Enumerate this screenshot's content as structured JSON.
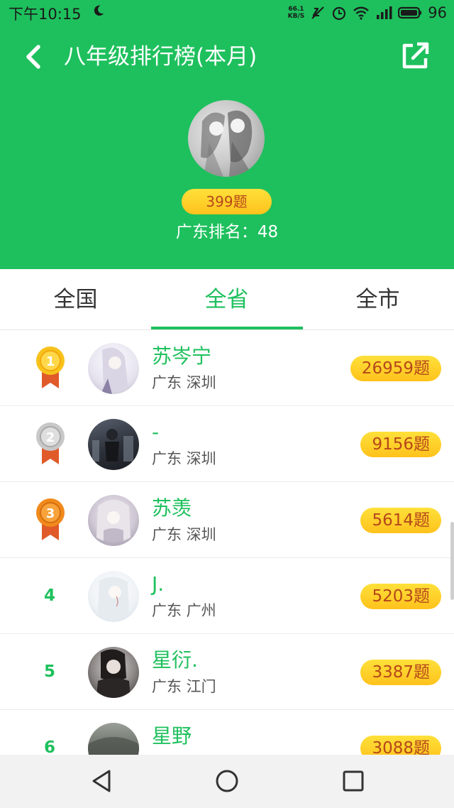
{
  "status_bar": {
    "time": "下午10:15",
    "net_speed_value": "66.1",
    "net_speed_unit": "KB/S",
    "battery": "96"
  },
  "header": {
    "title": "八年级排行榜(本月)",
    "my_score": "399题",
    "my_rank": "广东排名：48"
  },
  "tabs": [
    {
      "label": "全国",
      "active": false
    },
    {
      "label": "全省",
      "active": true
    },
    {
      "label": "全市",
      "active": false
    }
  ],
  "leaderboard": [
    {
      "rank": "1",
      "name": "苏岑宁",
      "location": "广东 深圳",
      "count": "26959题",
      "medal": "gold"
    },
    {
      "rank": "2",
      "name": "-",
      "location": "广东 深圳",
      "count": "9156题",
      "medal": "silver"
    },
    {
      "rank": "3",
      "name": "苏羡",
      "location": "广东 深圳",
      "count": "5614题",
      "medal": "bronze"
    },
    {
      "rank": "4",
      "name": "J.",
      "location": "广东 广州",
      "count": "5203题",
      "medal": "none"
    },
    {
      "rank": "5",
      "name": "星衍.",
      "location": "广东 江门",
      "count": "3387题",
      "medal": "none"
    },
    {
      "rank": "6",
      "name": "星野",
      "location": "",
      "count": "3088题",
      "medal": "none"
    }
  ],
  "colors": {
    "brand_green": "#1ec05d",
    "pill_yellow": "#ffd22b",
    "pill_text": "#b6471a",
    "gold": "#f7c21a",
    "silver": "#c8c8c8",
    "bronze": "#f08a1c",
    "ribbon": "#e05a2a"
  },
  "icons": {
    "back": "back-arrow-icon",
    "share": "share-external-icon",
    "nav_back": "triangle-back-icon",
    "nav_home": "circle-home-icon",
    "nav_recent": "square-recents-icon"
  }
}
